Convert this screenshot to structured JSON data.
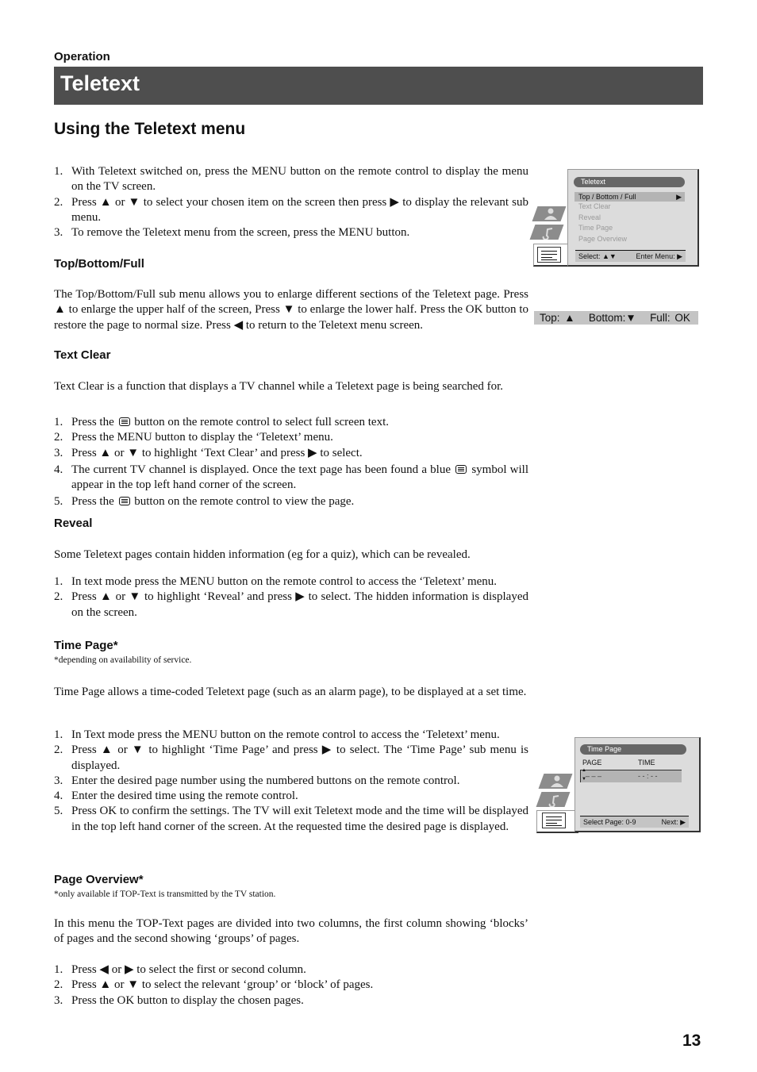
{
  "header": {
    "section_label": "Operation",
    "title": "Teletext"
  },
  "subtitle": "Using the Teletext menu",
  "intro_steps": [
    {
      "n": "1.",
      "text": "With Teletext switched on, press the MENU button on the remote control to display the menu on the TV screen."
    },
    {
      "n": "2.",
      "text": "Press ▲ or ▼ to select your chosen item on the screen then press ▶ to display the relevant sub menu."
    },
    {
      "n": "3.",
      "text": "To remove the Teletext menu from the screen, press the MENU button."
    }
  ],
  "teletext_menu_osd": {
    "title": "Teletext",
    "items": [
      "Top / Bottom / Full",
      "Text Clear",
      "Reveal",
      "Time  Page",
      "Page Overview"
    ],
    "selected_index": 0,
    "selected_arrow": "▶",
    "footer_left": "Select: ▲▼",
    "footer_right": "Enter Menu: ▶"
  },
  "top_bottom_full": {
    "heading": "Top/Bottom/Full",
    "paragraph": "The Top/Bottom/Full sub menu allows you to enlarge different sections of the Teletext page. Press ▲ to enlarge the upper half of the screen, Press ▼ to enlarge the lower half. Press the OK button to restore the page to normal size. Press ◀ to return to the Teletext menu screen.",
    "osd_bar": {
      "top": "Top: ▲",
      "bottom": "Bottom:▼",
      "full": "Full: OK"
    }
  },
  "text_clear": {
    "heading": "Text Clear",
    "paragraph": "Text Clear is a function that displays a TV channel while a Teletext page is being searched for.",
    "steps": [
      {
        "n": "1.",
        "before": "Press the",
        "after": "button on the remote control to select full screen text."
      },
      {
        "n": "2.",
        "text": "Press the MENU button to display the ‘Teletext’ menu."
      },
      {
        "n": "3.",
        "text": "Press ▲ or ▼ to highlight ‘Text Clear’ and press ▶ to select."
      },
      {
        "n": "4.",
        "before": "The current TV channel is displayed. Once the text page has been found a blue",
        "after": "symbol will appear in the top left hand corner of the screen."
      },
      {
        "n": "5.",
        "before": "Press the",
        "after": "button on the remote control to view the page."
      }
    ]
  },
  "reveal": {
    "heading": "Reveal",
    "paragraph": "Some Teletext pages contain hidden information (eg for a quiz), which can be revealed.",
    "steps": [
      {
        "n": "1.",
        "text": "In text mode press the MENU button on the remote control to access the ‘Teletext’ menu."
      },
      {
        "n": "2.",
        "text": "Press ▲ or ▼ to highlight ‘Reveal’ and press ▶ to select. The hidden information is displayed on the screen."
      }
    ]
  },
  "time_page": {
    "heading": "Time Page*",
    "note": "*depending on availability of service.",
    "paragraph": "Time Page allows a time-coded Teletext page (such as an alarm page), to be displayed at a set time.",
    "steps": [
      {
        "n": "1.",
        "text": "In Text mode press the MENU button on the remote control to access the ‘Teletext’ menu."
      },
      {
        "n": "2.",
        "text": "Press ▲ or ▼ to highlight ‘Time Page’ and press ▶ to select. The ‘Time Page’ sub menu is displayed."
      },
      {
        "n": "3.",
        "text": "Enter the desired page number using the numbered buttons on the remote control."
      },
      {
        "n": "4.",
        "text": "Enter the desired time using the remote control."
      },
      {
        "n": "5.",
        "text": "Press OK to confirm the settings. The TV will exit Teletext mode and the time will be displayed in the top left hand corner of the screen. At the requested time the desired page is displayed."
      }
    ],
    "osd": {
      "title": "Time  Page",
      "col_page": "PAGE",
      "col_time": "TIME",
      "page_value": "– – –",
      "time_value": "- - : - -",
      "footer_left": "Select Page: 0-9",
      "footer_right": "Next: ▶"
    }
  },
  "page_overview": {
    "heading": "Page Overview*",
    "note": "*only available if TOP-Text is transmitted by the TV station.",
    "paragraph": "In this menu the TOP-Text pages are divided into two columns, the first column showing ‘blocks’ of pages and the second showing ‘groups’ of pages.",
    "steps": [
      {
        "n": "1.",
        "text": "Press ◀ or ▶ to select the first or second column."
      },
      {
        "n": "2.",
        "text": "Press ▲ or ▼ to select the relevant ‘group’ or ‘block’ of pages."
      },
      {
        "n": "3.",
        "text": "Press the OK button to display the chosen pages."
      }
    ]
  },
  "page_number": "13"
}
